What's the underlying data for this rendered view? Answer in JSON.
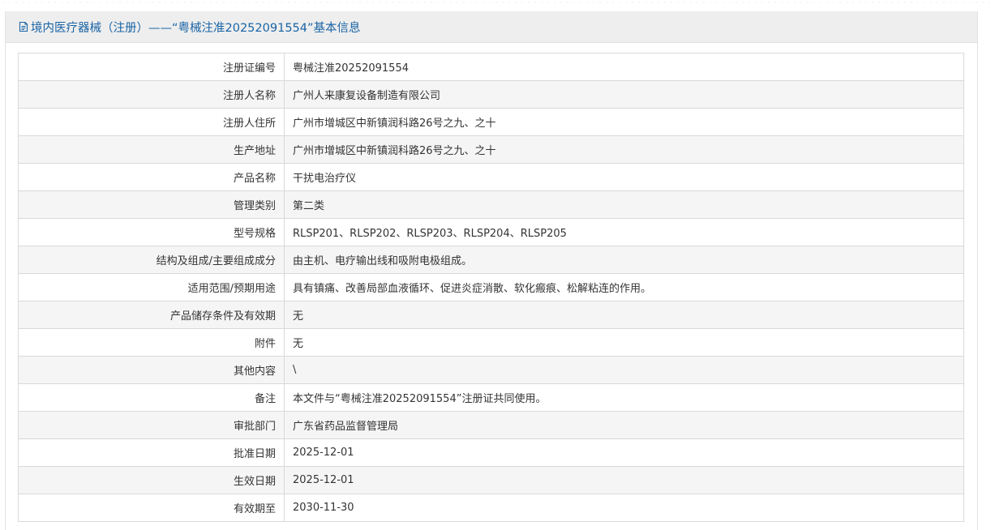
{
  "header": {
    "title": "境内医疗器械（注册）——“粤械注准20252091554”基本信息",
    "icon": "document-icon"
  },
  "rows": [
    {
      "label": "注册证编号",
      "value": "粤械注准20252091554"
    },
    {
      "label": "注册人名称",
      "value": "广州人来康复设备制造有限公司"
    },
    {
      "label": "注册人住所",
      "value": "广州市增城区中新镇润科路26号之九、之十"
    },
    {
      "label": "生产地址",
      "value": "广州市增城区中新镇润科路26号之九、之十"
    },
    {
      "label": "产品名称",
      "value": "干扰电治疗仪"
    },
    {
      "label": "管理类别",
      "value": "第二类"
    },
    {
      "label": "型号规格",
      "value": "RLSP201、RLSP202、RLSP203、RLSP204、RLSP205"
    },
    {
      "label": "结构及组成/主要组成成分",
      "value": "由主机、电疗输出线和吸附电极组成。"
    },
    {
      "label": "适用范围/预期用途",
      "value": "具有镇痛、改善局部血液循环、促进炎症消散、软化瘢痕、松解粘连的作用。"
    },
    {
      "label": "产品储存条件及有效期",
      "value": "无"
    },
    {
      "label": "附件",
      "value": "无"
    },
    {
      "label": "其他内容",
      "value": "\\"
    },
    {
      "label": "备注",
      "value": "本文件与“粤械注准20252091554”注册证共同使用。"
    },
    {
      "label": "审批部门",
      "value": "广东省药品监督管理局"
    },
    {
      "label": "批准日期",
      "value": "2025-12-01"
    },
    {
      "label": "生效日期",
      "value": "2025-12-01"
    },
    {
      "label": "有效期至",
      "value": "2030-11-30"
    }
  ],
  "colors": {
    "header_text": "#1a64a5",
    "header_bg": "#eeeeee",
    "row_alt_bg": "#f5f5f5",
    "border": "#d9d9d9",
    "text": "#333333"
  }
}
